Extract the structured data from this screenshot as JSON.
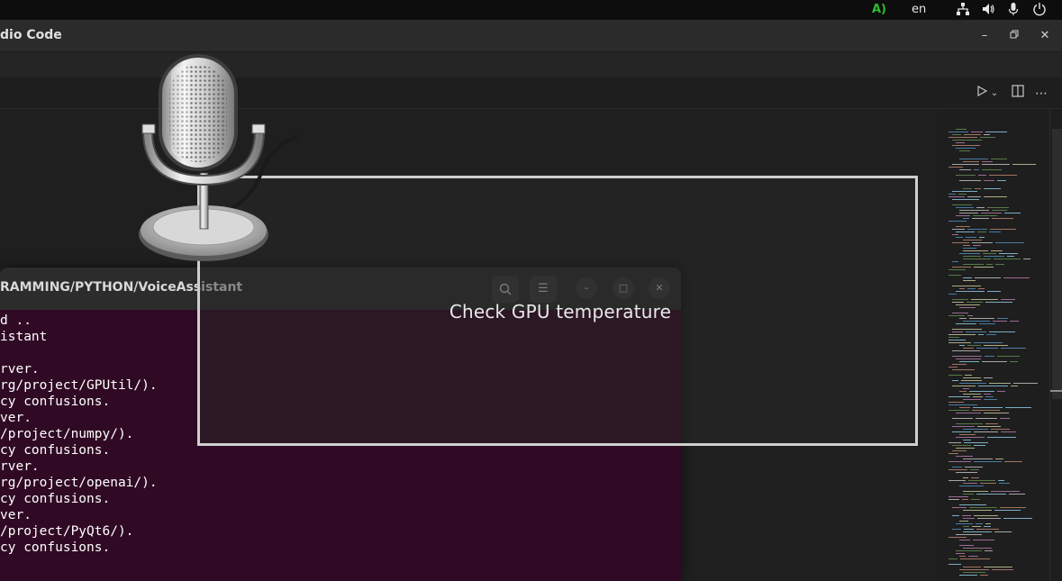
{
  "system_bar": {
    "tray_icon_label": "A)",
    "keyboard_layout": "en",
    "icons": [
      "network-icon",
      "volume-icon",
      "microphone-icon",
      "power-icon"
    ]
  },
  "vscode": {
    "window_title": "dio Code",
    "window_buttons": [
      "minimize-icon",
      "restore-icon",
      "close-icon"
    ],
    "editor_actions": [
      "run-icon",
      "chevron-down-icon",
      "split-editor-icon",
      "more-icon"
    ]
  },
  "terminal": {
    "title": "RAMMING/PYTHON/VoiceAssistant",
    "lines": [
      "d ..",
      "istant",
      "",
      "rver.",
      "rg/project/GPUtil/).",
      "cy confusions.",
      "ver.",
      "/project/numpy/).",
      "cy confusions.",
      "rver.",
      "rg/project/openai/).",
      "cy confusions.",
      "ver.",
      "/project/PyQt6/).",
      "cy confusions."
    ]
  },
  "overlay": {
    "caption": "Check GPU temperature"
  },
  "colors": {
    "terminal_bg": "#300a24",
    "terminal_header": "#2c2c2c",
    "editor_bg": "#1f1f1f",
    "tray_green": "#2ebd2e"
  }
}
